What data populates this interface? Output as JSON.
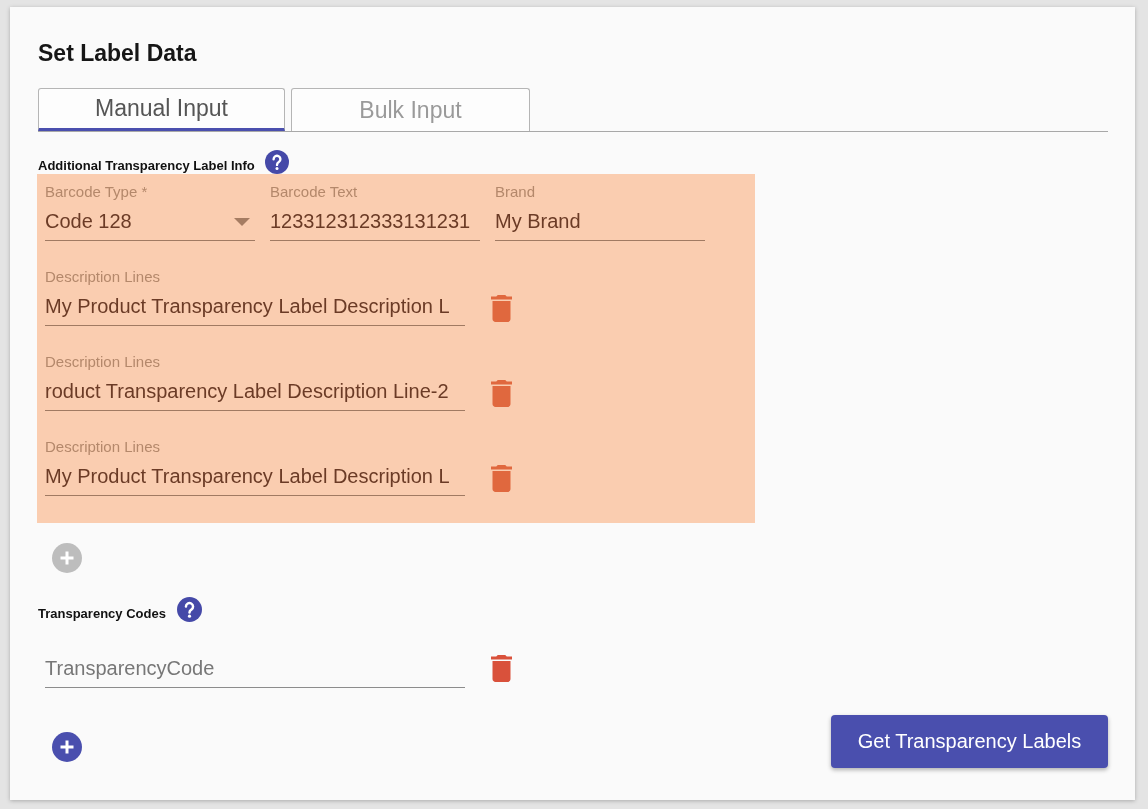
{
  "card": {
    "title": "Set Label Data"
  },
  "tabs": [
    {
      "label": "Manual Input",
      "selected": true
    },
    {
      "label": "Bulk Input",
      "selected": false
    }
  ],
  "label_info": {
    "heading": "Additional Transparency Label Info",
    "highlighted": true,
    "fields": [
      {
        "kind": "select",
        "label": "Barcode Type *",
        "value": "Code 128"
      },
      {
        "kind": "text",
        "label": "Barcode Text",
        "value": "123312312333131231"
      },
      {
        "kind": "text",
        "label": "Brand",
        "value": "My Brand"
      }
    ],
    "description_lines": [
      {
        "label": "Description Lines",
        "value": "My Product Transparency Label Description L"
      },
      {
        "label": "Description Lines",
        "value": "roduct Transparency Label Description Line-2"
      },
      {
        "label": "Description Lines",
        "value": "My Product Transparency Label Description L"
      }
    ],
    "add_button": {
      "disabled": true
    }
  },
  "transparency_codes": {
    "heading": "Transparency Codes",
    "codes": [
      {
        "placeholder": "TransparencyCode"
      }
    ],
    "add_button": {
      "disabled": false
    }
  },
  "submit_button": {
    "label": "Get Transparency Labels"
  }
}
